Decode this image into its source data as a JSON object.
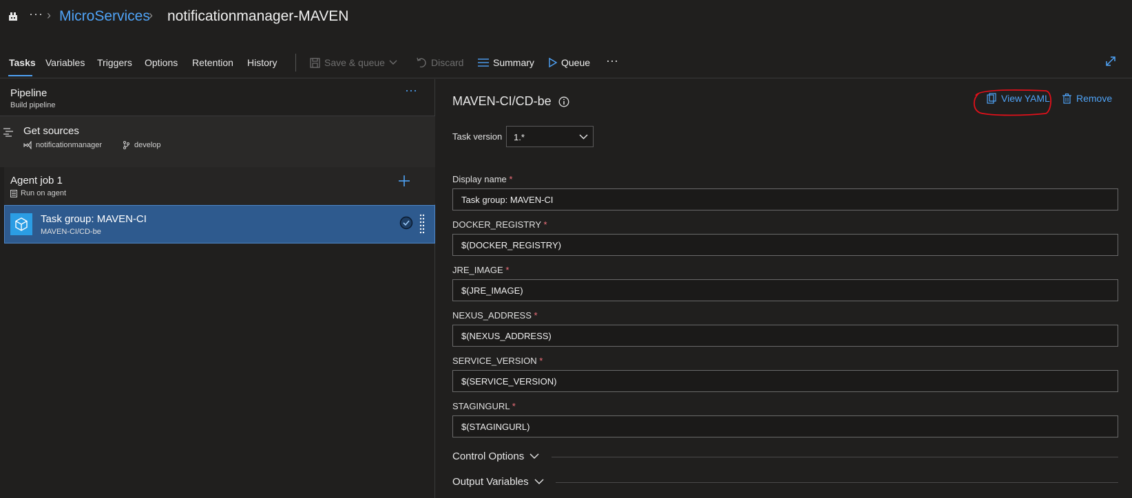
{
  "breadcrumb": {
    "more": "···",
    "project": "MicroServices",
    "pipeline_name": "notificationmanager-MAVEN"
  },
  "tabs": [
    "Tasks",
    "Variables",
    "Triggers",
    "Options",
    "Retention",
    "History"
  ],
  "toolbar": {
    "save_queue": "Save & queue",
    "discard": "Discard",
    "summary": "Summary",
    "queue": "Queue",
    "more": "···"
  },
  "pipeline": {
    "title": "Pipeline",
    "subtitle": "Build pipeline",
    "more": "···"
  },
  "sources": {
    "title": "Get sources",
    "repo": "notificationmanager",
    "branch": "develop"
  },
  "agent_job": {
    "title": "Agent job 1",
    "subtitle": "Run on agent"
  },
  "task_group": {
    "title": "Task group: MAVEN-CI",
    "subtitle": "MAVEN-CI/CD-be"
  },
  "detail": {
    "title": "MAVEN-CI/CD-be",
    "view_yaml": "View YAML",
    "remove": "Remove",
    "task_version_label": "Task version",
    "task_version_value": "1.*",
    "required_mark": "*",
    "fields": [
      {
        "label": "Display name",
        "value": "Task group: MAVEN-CI"
      },
      {
        "label": "DOCKER_REGISTRY",
        "value": "$(DOCKER_REGISTRY)"
      },
      {
        "label": "JRE_IMAGE",
        "value": "$(JRE_IMAGE)"
      },
      {
        "label": "NEXUS_ADDRESS",
        "value": "$(NEXUS_ADDRESS)"
      },
      {
        "label": "SERVICE_VERSION",
        "value": "$(SERVICE_VERSION)"
      },
      {
        "label": "STAGINGURL",
        "value": "$(STAGINGURL)"
      }
    ],
    "sections": [
      "Control Options",
      "Output Variables"
    ]
  },
  "colors": {
    "accent": "#4fa3f7",
    "selected_row": "#2e5a8e",
    "required": "#f1707b",
    "annotation": "#e0101a"
  }
}
